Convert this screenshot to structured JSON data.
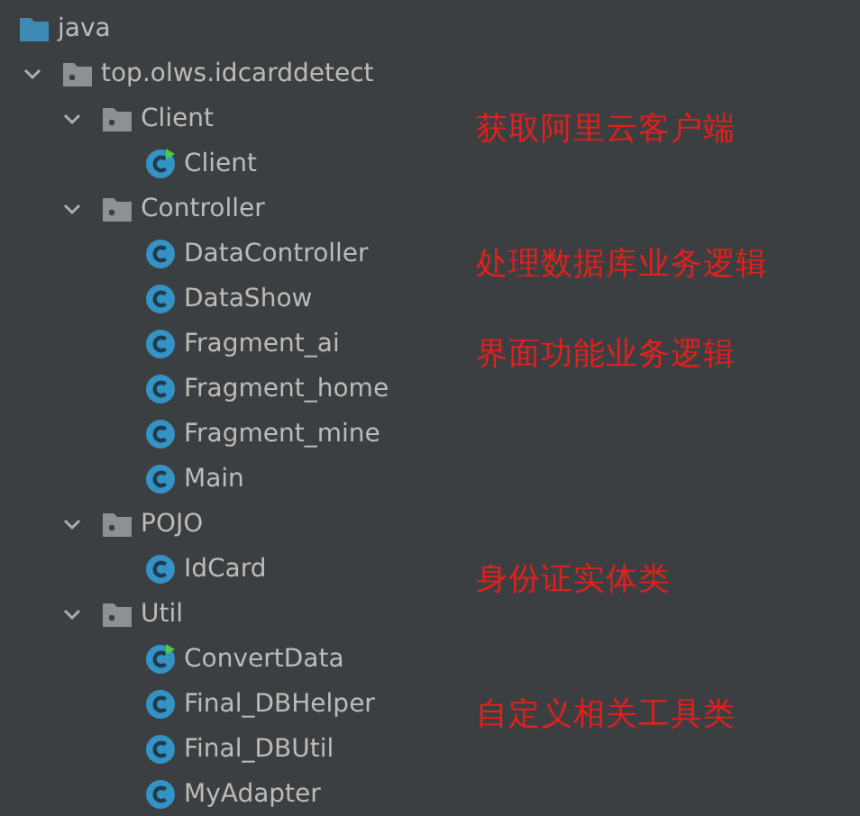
{
  "tree": [
    {
      "label": "java",
      "kind": "source_root",
      "children": [
        {
          "label": "top.olws.idcarddetect",
          "kind": "package",
          "expanded": true,
          "children": [
            {
              "label": "Client",
              "kind": "package",
              "expanded": true,
              "note": "获取阿里云客户端",
              "children": [
                {
                  "label": "Client",
                  "kind": "class",
                  "runnable": true
                }
              ]
            },
            {
              "label": "Controller",
              "kind": "package",
              "expanded": true,
              "children": [
                {
                  "label": "DataController",
                  "kind": "class",
                  "runnable": false,
                  "note": "处理数据库业务逻辑"
                },
                {
                  "label": "DataShow",
                  "kind": "class",
                  "runnable": false
                },
                {
                  "label": "Fragment_ai",
                  "kind": "class",
                  "runnable": false,
                  "note": "界面功能业务逻辑"
                },
                {
                  "label": "Fragment_home",
                  "kind": "class",
                  "runnable": false
                },
                {
                  "label": "Fragment_mine",
                  "kind": "class",
                  "runnable": false
                },
                {
                  "label": "Main",
                  "kind": "class",
                  "runnable": false
                }
              ]
            },
            {
              "label": "POJO",
              "kind": "package",
              "expanded": true,
              "children": [
                {
                  "label": "IdCard",
                  "kind": "class",
                  "runnable": false,
                  "note": "身份证实体类"
                }
              ]
            },
            {
              "label": "Util",
              "kind": "package",
              "expanded": true,
              "children": [
                {
                  "label": "ConvertData",
                  "kind": "class",
                  "runnable": true
                },
                {
                  "label": "Final_DBHelper",
                  "kind": "class",
                  "runnable": false,
                  "note": "自定义相关工具类"
                },
                {
                  "label": "Final_DBUtil",
                  "kind": "class",
                  "runnable": false
                },
                {
                  "label": "MyAdapter",
                  "kind": "class",
                  "runnable": false
                }
              ]
            }
          ]
        }
      ]
    }
  ]
}
